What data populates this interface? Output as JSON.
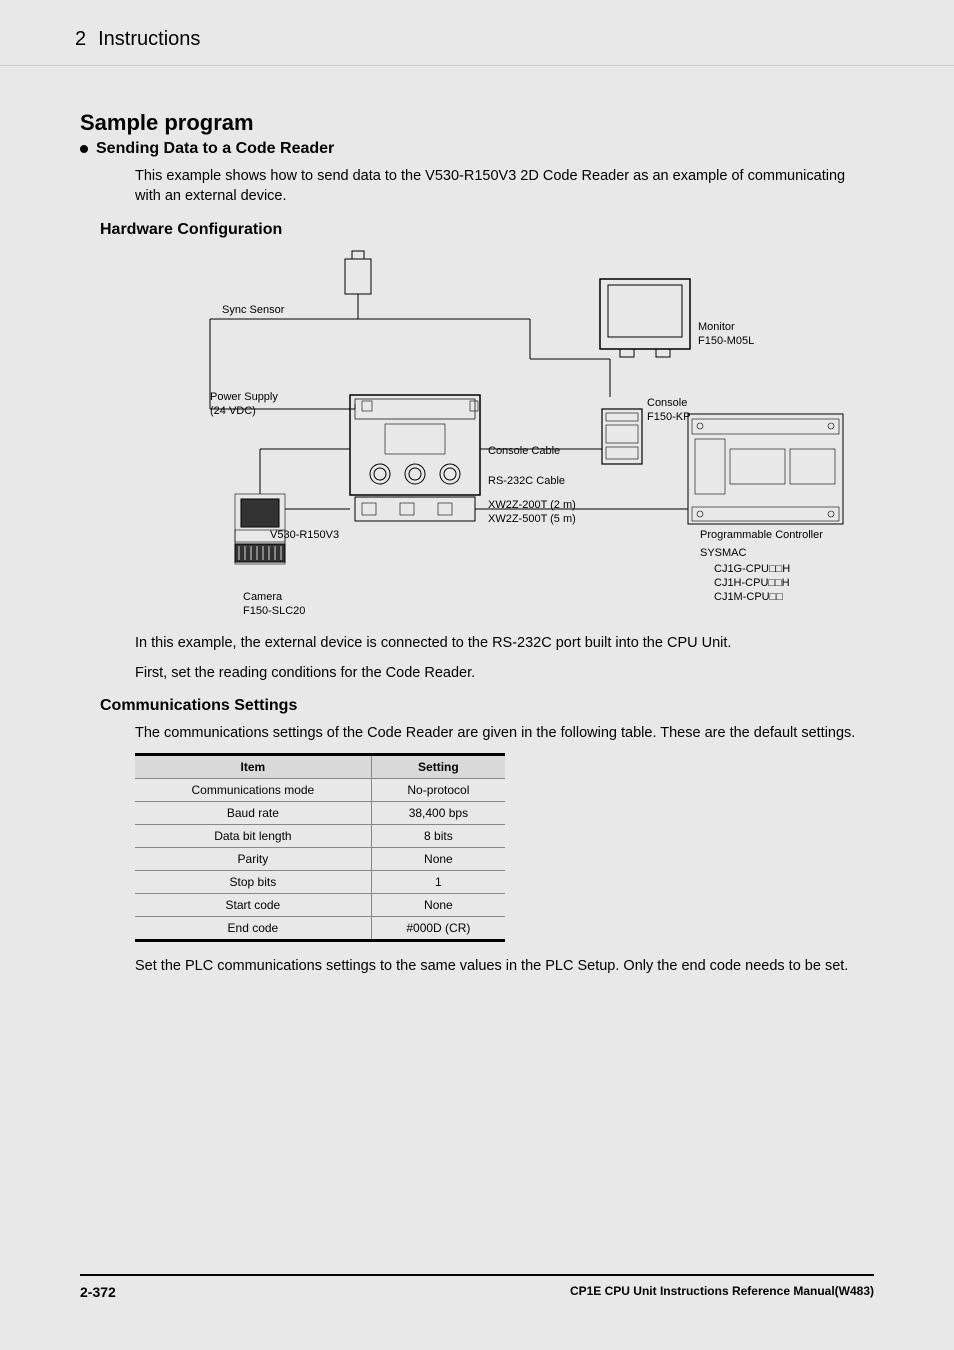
{
  "header": {
    "number": "2",
    "title": "Instructions"
  },
  "h1": "Sample program",
  "h2_bullet": "Sending Data to a Code Reader",
  "intro_para": "This example shows how to send data to the V530-R150V3 2D Code Reader as an example of communicating with an external device.",
  "h3_hw": "Hardware Configuration",
  "diagram": {
    "sync_sensor": "Sync Sensor",
    "monitor": "Monitor",
    "monitor_model": "F150-M05L",
    "power_supply": "Power Supply",
    "power_supply_sub": "(24 VDC)",
    "console": "Console",
    "console_model": "F150-KP",
    "console_cable": "Console Cable",
    "rs232c": "RS-232C Cable",
    "xw2z1": "XW2Z-200T (2 m)",
    "xw2z2": "XW2Z-500T (5 m)",
    "v530": "V530-R150V3",
    "prog_ctrl": "Programmable Controller",
    "sysmac": "SYSMAC",
    "cj1g": "CJ1G-CPU□□H",
    "cj1h": "CJ1H-CPU□□H",
    "cj1m": "CJ1M-CPU□□",
    "camera": "Camera",
    "camera_model": "F150-SLC20"
  },
  "para_mid1": "In this example, the external device is connected to the RS-232C port built into the CPU Unit.",
  "para_mid2": "First, set the reading conditions for the Code Reader.",
  "h3_comm": "Communications Settings",
  "para_comm": "The communications settings of the Code Reader are given in the following table. These are the default settings.",
  "table": {
    "head_item": "Item",
    "head_setting": "Setting",
    "rows": [
      {
        "item": "Communications mode",
        "setting": "No-protocol"
      },
      {
        "item": "Baud rate",
        "setting": "38,400 bps"
      },
      {
        "item": "Data bit length",
        "setting": "8 bits"
      },
      {
        "item": "Parity",
        "setting": "None"
      },
      {
        "item": "Stop bits",
        "setting": "1"
      },
      {
        "item": "Start code",
        "setting": "None"
      },
      {
        "item": "End code",
        "setting": "#000D (CR)"
      }
    ]
  },
  "para_end": "Set the PLC communications settings to the same values in the PLC Setup. Only the end code needs to be set.",
  "footer": {
    "page": "2-372",
    "manual": "CP1E CPU Unit Instructions Reference Manual(W483)"
  }
}
